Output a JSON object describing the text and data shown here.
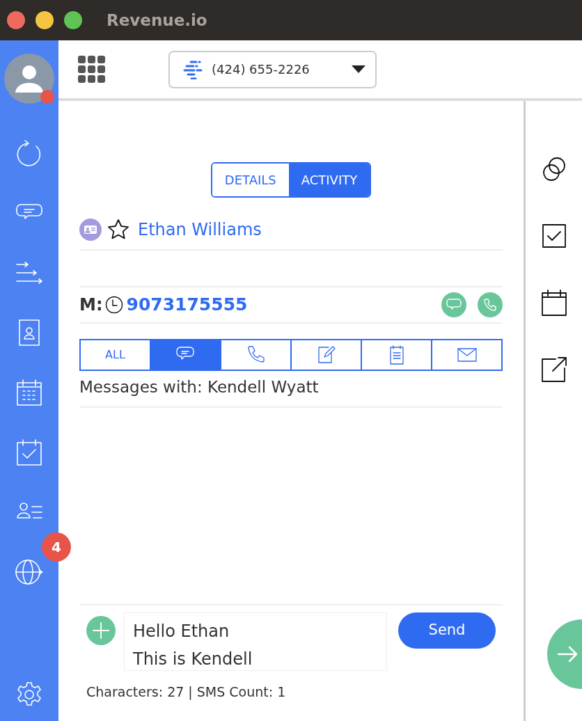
{
  "window": {
    "title": "Revenue.io"
  },
  "sidebar": {
    "items": [
      {
        "kind": "refresh"
      },
      {
        "kind": "chat"
      },
      {
        "kind": "queue"
      },
      {
        "kind": "contacts"
      },
      {
        "kind": "calendar"
      },
      {
        "kind": "tasks"
      },
      {
        "kind": "people-list"
      },
      {
        "kind": "globe",
        "badge": "4"
      }
    ],
    "bottom": {
      "kind": "settings"
    }
  },
  "caller_id": {
    "value": "(424) 655-2226"
  },
  "tabs": [
    {
      "label": "DETAILS",
      "selected": false
    },
    {
      "label": "ACTIVITY",
      "selected": true
    }
  ],
  "contact": {
    "name": "Ethan Williams",
    "favorite": false
  },
  "phone": {
    "label": "M:",
    "number": "9073175555"
  },
  "filters": [
    {
      "kind": "all",
      "label": "ALL",
      "selected": false
    },
    {
      "kind": "sms",
      "selected": true
    },
    {
      "kind": "call",
      "selected": false
    },
    {
      "kind": "note",
      "selected": false
    },
    {
      "kind": "task",
      "selected": false
    },
    {
      "kind": "email",
      "selected": false
    }
  ],
  "messages_with": "Messages with: Kendell Wyatt",
  "composer": {
    "lines": [
      "Hello Ethan",
      "This is Kendell"
    ],
    "send": "Send",
    "counter": "Characters: 27 | SMS Count: 1"
  },
  "right_tools": [
    {
      "kind": "link"
    },
    {
      "kind": "task"
    },
    {
      "kind": "calendar"
    },
    {
      "kind": "external"
    }
  ]
}
